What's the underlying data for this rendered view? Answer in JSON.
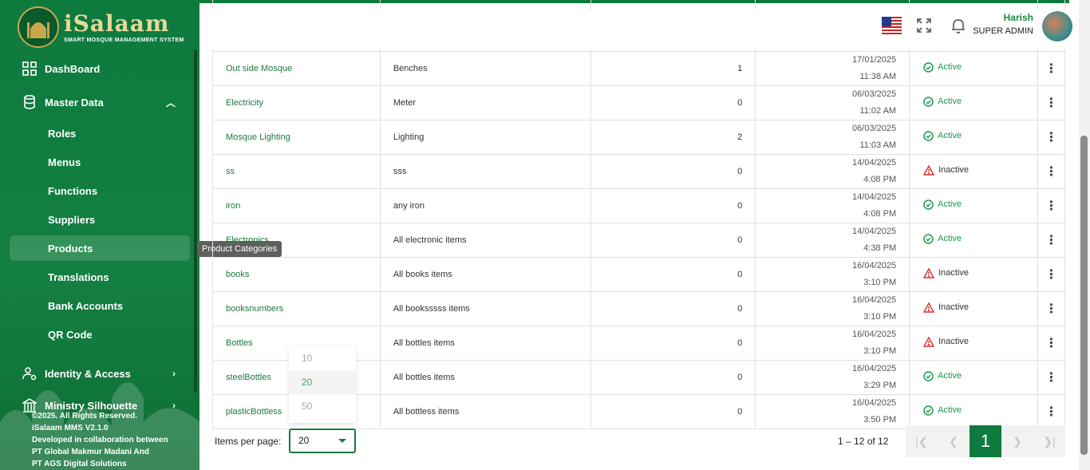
{
  "brand": {
    "name": "iSalaam",
    "subtitle": "SMART MOSQUE MANAGEMENT SYSTEM"
  },
  "sidebar": {
    "items": [
      {
        "label": "DashBoard",
        "icon": "grid-icon"
      },
      {
        "label": "Master Data",
        "icon": "database-icon",
        "expanded": true
      },
      {
        "label": "Identity & Access",
        "icon": "user-gear-icon"
      },
      {
        "label": "Ministry Silhouette",
        "icon": "building-icon"
      }
    ],
    "sub_items": [
      "Roles",
      "Menus",
      "Functions",
      "Suppliers",
      "Products",
      "Translations",
      "Bank Accounts",
      "QR Code"
    ],
    "active_sub": "Products",
    "tooltip": "Product Categories",
    "footer": [
      "©2025. All Rights Reserved.",
      "iSalaam MMS V2.1.0",
      "Developed in collaboration between",
      "PT Global Makmur Madani And",
      "PT AGS Digital Solutions"
    ]
  },
  "header": {
    "user_name": "Harish",
    "user_role": "SUPER ADMIN"
  },
  "table": {
    "rows": [
      {
        "name": "Out side Mosque",
        "description": "Benches",
        "count": "1",
        "date": "17/01/2025",
        "time": "11:38 AM",
        "status": "Active"
      },
      {
        "name": "Electricity",
        "description": "Meter",
        "count": "0",
        "date": "06/03/2025",
        "time": "11:02 AM",
        "status": "Active"
      },
      {
        "name": "Mosque Lighting",
        "description": "Lighting",
        "count": "2",
        "date": "06/03/2025",
        "time": "11:03 AM",
        "status": "Active"
      },
      {
        "name": "ss",
        "description": "sss",
        "count": "0",
        "date": "14/04/2025",
        "time": "4:08 PM",
        "status": "Inactive"
      },
      {
        "name": "iron",
        "description": "any iron",
        "count": "0",
        "date": "14/04/2025",
        "time": "4:08 PM",
        "status": "Active"
      },
      {
        "name": "Electronics",
        "description": "All electronic items",
        "count": "0",
        "date": "14/04/2025",
        "time": "4:38 PM",
        "status": "Active"
      },
      {
        "name": "books",
        "description": "All books items",
        "count": "0",
        "date": "16/04/2025",
        "time": "3:10 PM",
        "status": "Inactive"
      },
      {
        "name": "booksnumbers",
        "description": "All booksssss items",
        "count": "0",
        "date": "16/04/2025",
        "time": "3:10 PM",
        "status": "Inactive"
      },
      {
        "name": "Bottles",
        "description": "All bottles items",
        "count": "0",
        "date": "16/04/2025",
        "time": "3:10 PM",
        "status": "Inactive"
      },
      {
        "name": "steelBottles",
        "description": "All bottles items",
        "count": "0",
        "date": "16/04/2025",
        "time": "3:29 PM",
        "status": "Active"
      },
      {
        "name": "plasticBottless",
        "description": "All bottless items",
        "count": "0",
        "date": "16/04/2025",
        "time": "3:50 PM",
        "status": "Active"
      }
    ]
  },
  "pagination": {
    "items_per_page_label": "Items per page:",
    "items_per_page": "20",
    "options": [
      "10",
      "20",
      "50"
    ],
    "range": "1 – 12 of 12",
    "current_page": "1"
  },
  "colors": {
    "primary": "#0e7a3e",
    "active": "#1a9a4c",
    "inactive": "#d9302c"
  }
}
